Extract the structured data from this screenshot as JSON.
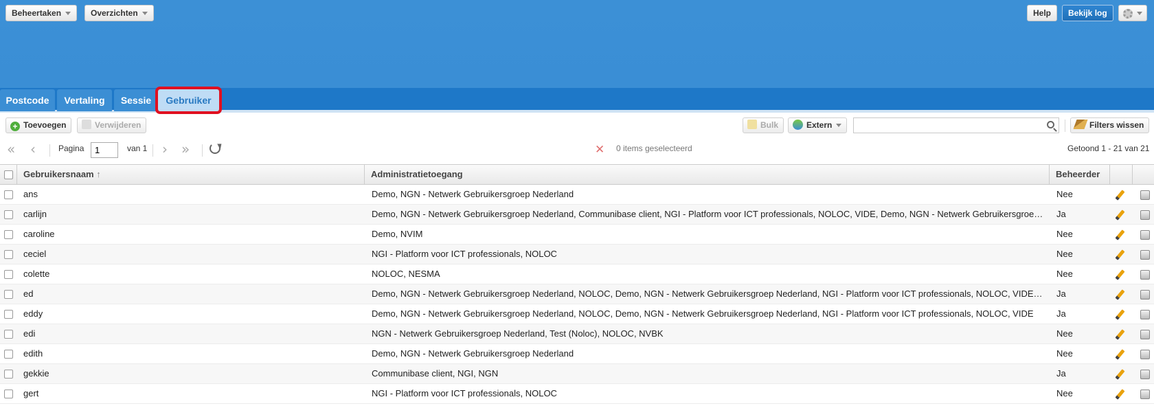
{
  "header": {
    "menu_beheertaken": "Beheertaken",
    "menu_overzichten": "Overzichten",
    "help": "Help",
    "bekijk_log": "Bekijk log"
  },
  "tabs": [
    "Postcode",
    "Vertaling",
    "Sessie",
    "Gebruiker"
  ],
  "active_tab": "Gebruiker",
  "toolbar": {
    "add": "Toevoegen",
    "delete": "Verwijderen",
    "bulk": "Bulk",
    "extern": "Extern",
    "search_value": "",
    "clear_filters": "Filters wissen"
  },
  "pager": {
    "page_label": "Pagina",
    "page_value": "1",
    "of_label": "van 1",
    "selected": "0 items geselecteerd",
    "shown": "Getoond 1 - 21 van 21"
  },
  "table": {
    "columns": [
      "Gebruikersnaam",
      "Administratietoegang",
      "Beheerder"
    ],
    "sort_indicator": "↑",
    "rows": [
      {
        "name": "ans",
        "access": "Demo, NGN - Netwerk Gebruikersgroep Nederland",
        "admin": "Nee"
      },
      {
        "name": "carlijn",
        "access": "Demo, NGN - Netwerk Gebruikersgroep Nederland, Communibase client, NGI - Platform voor ICT professionals, NOLOC, VIDE, Demo, NGN - Netwerk Gebruikersgroep...",
        "admin": "Ja"
      },
      {
        "name": "caroline",
        "access": "Demo, NVIM",
        "admin": "Nee"
      },
      {
        "name": "ceciel",
        "access": "NGI - Platform voor ICT professionals, NOLOC",
        "admin": "Nee"
      },
      {
        "name": "colette",
        "access": "NOLOC, NESMA",
        "admin": "Nee"
      },
      {
        "name": "ed",
        "access": "Demo, NGN - Netwerk Gebruikersgroep Nederland, NOLOC, Demo, NGN - Netwerk Gebruikersgroep Nederland, NGI - Platform voor ICT professionals, NOLOC, VIDE, ...",
        "admin": "Ja"
      },
      {
        "name": "eddy",
        "access": "Demo, NGN - Netwerk Gebruikersgroep Nederland, NOLOC, Demo, NGN - Netwerk Gebruikersgroep Nederland, NGI - Platform voor ICT professionals, NOLOC, VIDE",
        "admin": "Ja"
      },
      {
        "name": "edi",
        "access": "NGN - Netwerk Gebruikersgroep Nederland, Test (Noloc), NOLOC, NVBK",
        "admin": "Nee"
      },
      {
        "name": "edith",
        "access": "Demo, NGN - Netwerk Gebruikersgroep Nederland",
        "admin": "Nee"
      },
      {
        "name": "gekkie",
        "access": "Communibase client, NGI, NGN",
        "admin": "Ja"
      },
      {
        "name": "gert",
        "access": "NGI - Platform voor ICT professionals, NOLOC",
        "admin": "Nee"
      }
    ]
  },
  "colors": {
    "header_blue": "#3b8fd5",
    "tabbar_blue": "#1e78c8",
    "active_tab_bg": "#bfdcf5",
    "highlight_red": "#e01020"
  },
  "icons": [
    "caret-down-icon",
    "gear-icon",
    "add-icon",
    "delete-icon",
    "bulk-icon",
    "extern-icon",
    "search-icon",
    "broom-icon",
    "first-page-icon",
    "prev-page-icon",
    "next-page-icon",
    "last-page-icon",
    "refresh-icon",
    "clear-selection-icon",
    "sort-asc-icon",
    "edit-icon",
    "trash-icon"
  ]
}
